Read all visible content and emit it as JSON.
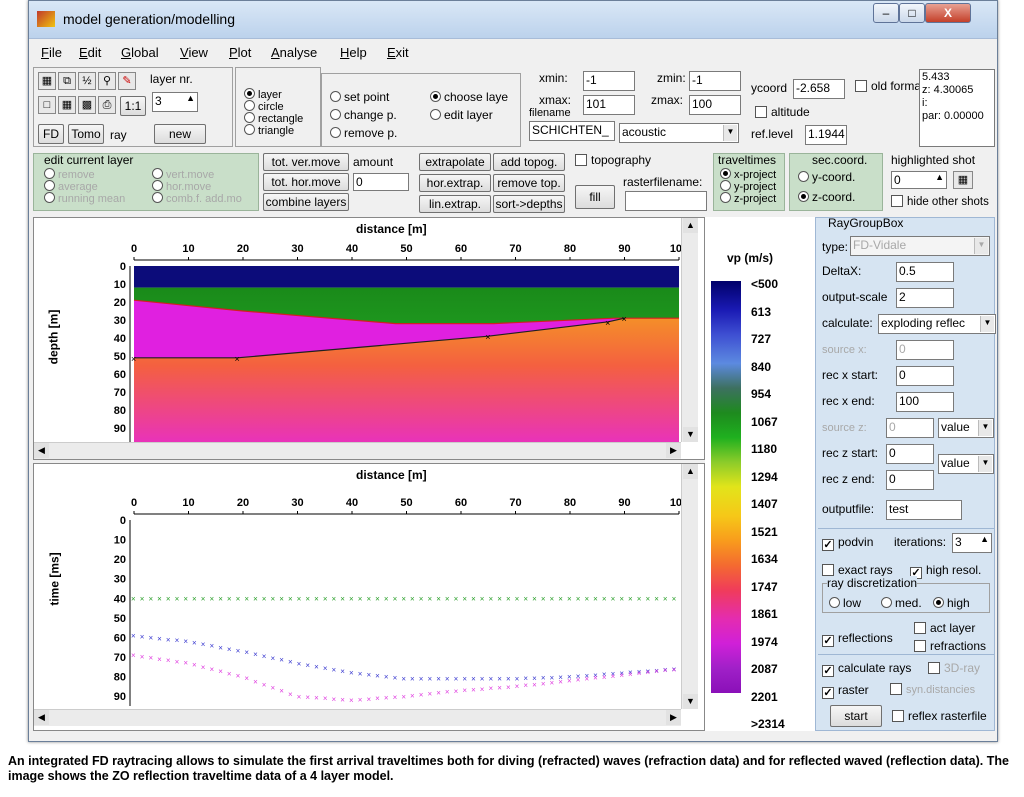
{
  "window": {
    "title": "model generation/modelling"
  },
  "menu": [
    "File",
    "Edit",
    "Global",
    "View",
    "Plot",
    "Analyse",
    "Help",
    "Exit"
  ],
  "toolbar": {
    "layer_nr_label": "layer nr.",
    "layer_nr_value": "3",
    "new_label": "new",
    "fd_label": "FD",
    "tomo_label": "Tomo",
    "ray_label": "ray",
    "one_to_one": "1:1",
    "icon_names": [
      "select-icon",
      "copy-icon",
      "ratio-icon",
      "zoom-icon",
      "pen-icon",
      "new-page-icon",
      "open-icon",
      "save-icon",
      "print-icon"
    ]
  },
  "shape_radios": [
    {
      "label": "layer",
      "on": true
    },
    {
      "label": "circle",
      "on": false
    },
    {
      "label": "rectangle",
      "on": false
    },
    {
      "label": "triangle",
      "on": false
    }
  ],
  "edit_radios": [
    {
      "label": "set point",
      "on": false
    },
    {
      "label": "change p.",
      "on": false
    },
    {
      "label": "remove p.",
      "on": false
    }
  ],
  "layer_radios": [
    {
      "label": "choose laye",
      "on": true
    },
    {
      "label": "edit layer",
      "on": false
    }
  ],
  "coords": {
    "xmin_label": "xmin:",
    "xmin": "-1",
    "xmax_label": "xmax:",
    "xmax": "101",
    "zmin_label": "zmin:",
    "zmin": "-1",
    "zmax_label": "zmax:",
    "zmax": "100",
    "filename_label": "filename",
    "filename": "SCHICHTEN_",
    "wave_type": "acoustic",
    "ycoord_label": "ycoord",
    "ycoord": "-2.658",
    "altitude_label": "altitude",
    "ref_level_label": "ref.level",
    "ref_level": "1.1944",
    "old_format_label": "old format",
    "readout": [
      "5.433",
      "z: 4.30065",
      "i:",
      "par: 0.00000"
    ]
  },
  "edit_current_layer": {
    "title": "edit current layer",
    "items": [
      "remove",
      "average",
      "running mean",
      "vert.move",
      "hor.move",
      "comb.f. add.mo"
    ]
  },
  "move_buttons": {
    "tot_ver": "tot. ver.move",
    "tot_hor": "tot. hor.move",
    "combine": "combine layers",
    "amount_label": "amount",
    "amount": "0"
  },
  "extrap_buttons": {
    "extrapolate": "extrapolate",
    "add_topog": "add topog.",
    "hor_extrap": "hor.extrap.",
    "remove_top": "remove top.",
    "lin_extrap": "lin.extrap.",
    "sort_depths": "sort->depths"
  },
  "topography": {
    "label": "topography",
    "raster_label": "rasterfilename:",
    "fill_label": "fill"
  },
  "traveltimes": {
    "title": "traveltimes",
    "options": [
      {
        "label": "x-project",
        "on": true
      },
      {
        "label": "y-project",
        "on": false
      },
      {
        "label": "z-project",
        "on": false
      }
    ]
  },
  "sec_coord": {
    "title": "sec.coord.",
    "options": [
      {
        "label": "y-coord.",
        "on": false
      },
      {
        "label": "z-coord.",
        "on": true
      }
    ]
  },
  "highlighted_shot": {
    "label": "highlighted shot",
    "value": "0",
    "hide_label": "hide other shots"
  },
  "plot1": {
    "xlabel": "distance [m]",
    "ylabel": "depth [m]",
    "xticks": [
      "0",
      "10",
      "20",
      "30",
      "40",
      "50",
      "60",
      "70",
      "80",
      "90",
      "100"
    ],
    "yticks": [
      "0",
      "10",
      "20",
      "30",
      "40",
      "50",
      "60",
      "70",
      "80",
      "90",
      "100"
    ]
  },
  "plot2": {
    "xlabel": "distance [m]",
    "ylabel": "time [ms]",
    "xticks": [
      "0",
      "10",
      "20",
      "30",
      "40",
      "50",
      "60",
      "70",
      "80",
      "90",
      "100"
    ],
    "yticks": [
      "0",
      "10",
      "20",
      "30",
      "40",
      "50",
      "60",
      "70",
      "80",
      "90"
    ]
  },
  "colorbar": {
    "title": "vp (m/s)",
    "labels": [
      "<500",
      "613",
      "727",
      "840",
      "954",
      "1067",
      "1180",
      "1294",
      "1407",
      "1521",
      "1634",
      "1747",
      "1861",
      "1974",
      "2087",
      "2201",
      ">2314"
    ]
  },
  "raygroup": {
    "title": "RayGroupBox",
    "type_label": "type:",
    "type_value": "FD-Vidale",
    "deltax_label": "DeltaX:",
    "deltax": "0.5",
    "outscale_label": "output-scale",
    "outscale": "2",
    "calculate_label": "calculate:",
    "calculate_value": "exploding reflec",
    "source_x_label": "source x:",
    "source_x": "0",
    "recx_start_label": "rec x start:",
    "recx_start": "0",
    "recx_end_label": "rec x end:",
    "recx_end": "100",
    "source_z_label": "source z:",
    "source_z": "0",
    "source_z_mode": "value",
    "recz_start_label": "rec z start:",
    "recz_start": "0",
    "recz_mode": "value",
    "recz_end_label": "rec z end:",
    "recz_end": "0",
    "outputfile_label": "outputfile:",
    "outputfile": "test",
    "podvin_label": "podvin",
    "iterations_label": "iterations:",
    "iterations": "3",
    "exact_rays_label": "exact rays",
    "high_resol_label": "high resol.",
    "ray_disc_title": "ray discretization",
    "ray_disc": [
      {
        "label": "low",
        "on": false
      },
      {
        "label": "med.",
        "on": false
      },
      {
        "label": "high",
        "on": true
      }
    ],
    "reflections_label": "reflections",
    "act_layer_label": "act layer",
    "refractions_label": "refractions",
    "calc_rays_label": "calculate rays",
    "ray3d_label": "3D-ray",
    "raster_label": "raster",
    "syn_label": "syn.distancies",
    "start_label": "start",
    "reflex_raster_label": "reflex rasterfile"
  },
  "model": {
    "x_range": [
      0,
      100
    ],
    "z_range": [
      0,
      100
    ],
    "layer1_boundary_z": 12,
    "layer2_boundary": {
      "x": [
        0,
        20,
        48,
        66,
        88,
        100
      ],
      "z": [
        19,
        25,
        32,
        32,
        29,
        29
      ]
    },
    "layer3_boundary": {
      "x": [
        0,
        19,
        65,
        87,
        90
      ],
      "z": [
        51,
        51,
        39,
        31,
        29
      ]
    }
  },
  "traveltime_data": {
    "x_range": [
      0,
      100
    ],
    "t_range": [
      0,
      95
    ],
    "series": [
      {
        "color": "#2ca02c",
        "x": [
          0,
          10,
          20,
          30,
          40,
          50,
          60,
          70,
          80,
          90,
          100
        ],
        "t": [
          40,
          40,
          40,
          40,
          40,
          40,
          40,
          40,
          40,
          40,
          40
        ]
      },
      {
        "color": "#3a3ad0",
        "x": [
          0,
          10,
          20,
          30,
          40,
          50,
          60,
          70,
          80,
          90,
          100
        ],
        "t": [
          59,
          62,
          67,
          73,
          78,
          81,
          81,
          81,
          80,
          78,
          76
        ]
      },
      {
        "color": "#e040e0",
        "x": [
          0,
          10,
          20,
          30,
          40,
          50,
          60,
          70,
          80,
          90,
          100
        ],
        "t": [
          69,
          73,
          80,
          90,
          92,
          90,
          87,
          85,
          82,
          79,
          76
        ]
      }
    ]
  },
  "caption": "An integrated FD raytracing allows to simulate the first arrival traveltimes both for diving (refracted) waves (refraction data) and for reflected waved (reflection data). The image shows the ZO reflection traveltime data of a 4 layer model."
}
